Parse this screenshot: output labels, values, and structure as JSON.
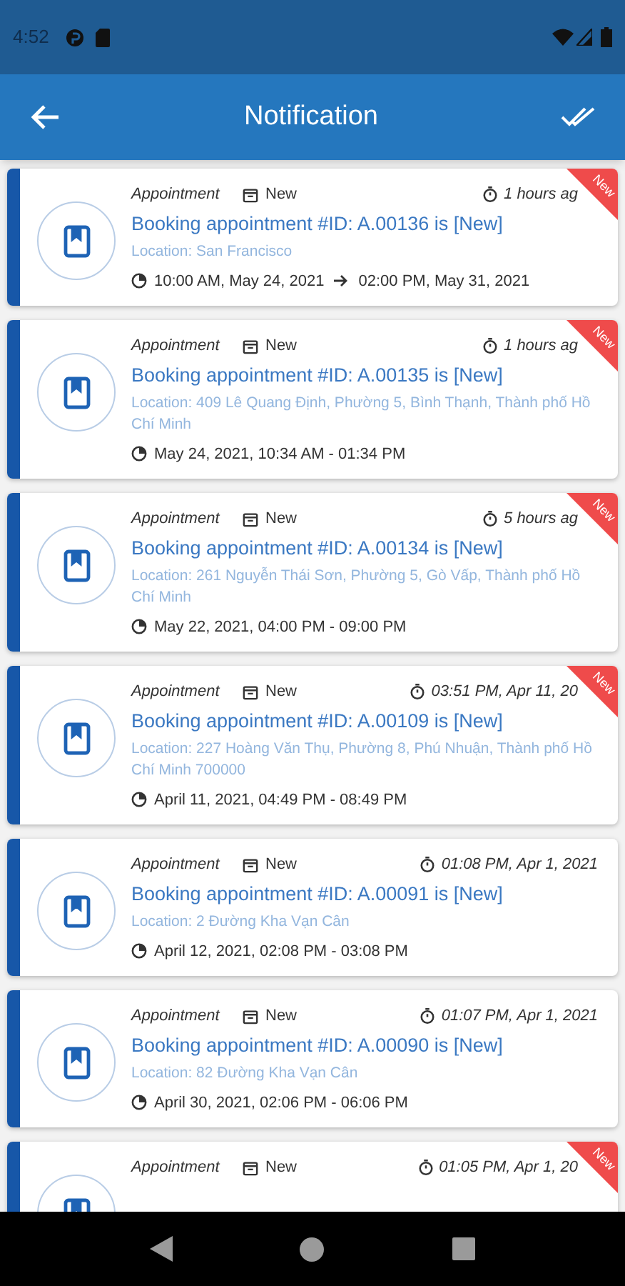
{
  "status_bar": {
    "time": "4:52"
  },
  "app_bar": {
    "title": "Notification"
  },
  "notifications": [
    {
      "category": "Appointment",
      "status": "New",
      "time": "1 hours ag",
      "ribbon": "New",
      "title": "Booking appointment #ID: A.00136 is [New]",
      "location": "Location: San Francisco",
      "schedule_start": "10:00 AM, May 24, 2021",
      "schedule_end": "02:00 PM, May 31, 2021"
    },
    {
      "category": "Appointment",
      "status": "New",
      "time": "1 hours ag",
      "ribbon": "New",
      "title": "Booking appointment #ID: A.00135 is [New]",
      "location": "Location: 409 Lê Quang Định, Phường 5, Bình Thạnh, Thành phố Hồ Chí Minh",
      "schedule": "May 24, 2021, 10:34 AM - 01:34 PM"
    },
    {
      "category": "Appointment",
      "status": "New",
      "time": "5 hours ag",
      "ribbon": "New",
      "title": "Booking appointment #ID: A.00134 is [New]",
      "location": "Location: 261 Nguyễn Thái Sơn, Phường 5, Gò Vấp, Thành phố Hồ Chí Minh",
      "schedule": "May 22, 2021, 04:00 PM - 09:00 PM"
    },
    {
      "category": "Appointment",
      "status": "New",
      "time": "03:51 PM, Apr 11, 20",
      "ribbon": "New",
      "title": "Booking appointment #ID: A.00109 is [New]",
      "location": "Location: 227 Hoàng Văn Thụ, Phường 8, Phú Nhuận, Thành phố Hồ Chí Minh 700000",
      "schedule": "April 11, 2021, 04:49 PM - 08:49 PM"
    },
    {
      "category": "Appointment",
      "status": "New",
      "time": "01:08 PM, Apr 1, 2021",
      "title": "Booking appointment #ID: A.00091 is [New]",
      "location": "Location: 2 Đường Kha Vạn Cân",
      "schedule": "April 12, 2021, 02:08 PM - 03:08 PM"
    },
    {
      "category": "Appointment",
      "status": "New",
      "time": "01:07 PM, Apr 1, 2021",
      "title": "Booking appointment #ID: A.00090 is [New]",
      "location": "Location: 82 Đường Kha Vạn Cân",
      "schedule": "April 30, 2021, 02:06 PM - 06:06 PM"
    },
    {
      "category": "Appointment",
      "status": "New",
      "time": "01:05 PM, Apr 1, 20",
      "ribbon": "New"
    }
  ]
}
